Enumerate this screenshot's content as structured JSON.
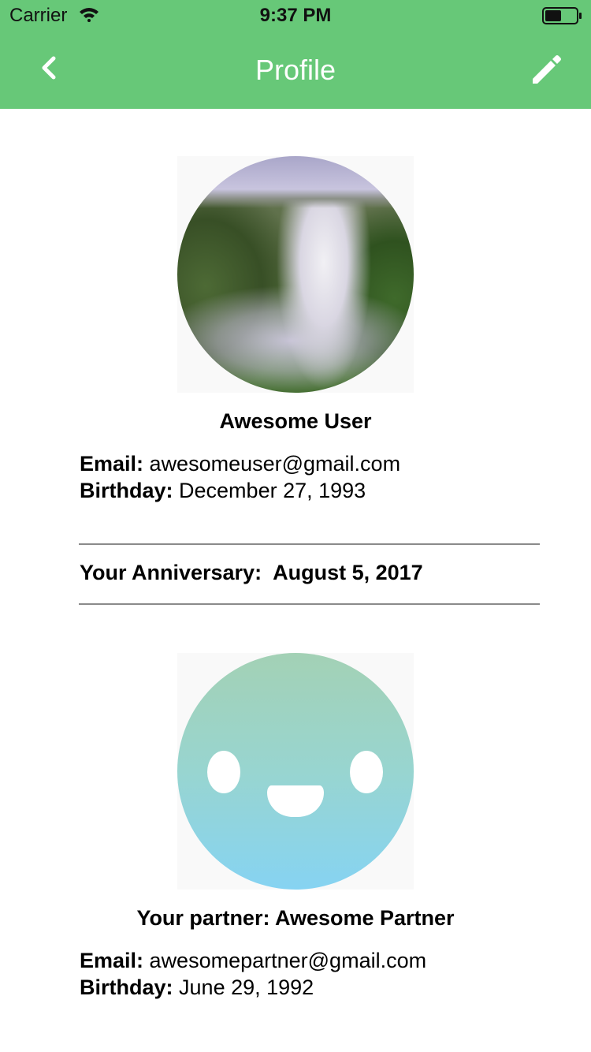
{
  "status_bar": {
    "carrier": "Carrier",
    "time": "9:37 PM"
  },
  "nav": {
    "title": "Profile",
    "back_icon": "chevron-left-icon",
    "edit_icon": "pencil-icon"
  },
  "user": {
    "name": "Awesome User",
    "email_label": "Email:",
    "email": "awesomeuser@gmail.com",
    "birthday_label": "Birthday:",
    "birthday": "December 27, 1993"
  },
  "anniversary": {
    "label": "Your Anniversary:",
    "date": "August 5, 2017"
  },
  "partner": {
    "name_line": "Your partner: Awesome Partner",
    "email_label": "Email:",
    "email": "awesomepartner@gmail.com",
    "birthday_label": "Birthday:",
    "birthday": "June 29, 1992"
  },
  "colors": {
    "header": "#67c878",
    "divider": "#8a8a8a"
  }
}
